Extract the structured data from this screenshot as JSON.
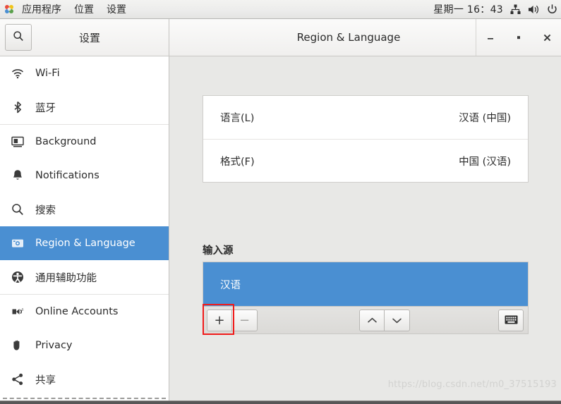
{
  "top_panel": {
    "app_icon_name": "gnome-applications-icon",
    "menus": [
      {
        "label": "应用程序",
        "name": "menu-applications"
      },
      {
        "label": "位置",
        "name": "menu-places"
      },
      {
        "label": "设置",
        "name": "menu-settings"
      }
    ],
    "clock": "星期一 16：43",
    "tray": [
      {
        "name": "network-icon"
      },
      {
        "name": "volume-icon"
      },
      {
        "name": "power-icon"
      }
    ]
  },
  "header": {
    "search_icon": "search-icon",
    "sidebar_title": "设置",
    "page_title": "Region & Language",
    "window_controls": {
      "minimize": "minimize-icon",
      "maximize": "maximize-icon",
      "close": "close-icon"
    }
  },
  "sidebar": {
    "items": [
      {
        "label": "Wi-Fi",
        "icon": "wifi-icon",
        "selected": false
      },
      {
        "label": "蓝牙",
        "icon": "bluetooth-icon",
        "selected": false
      },
      {
        "label": "Background",
        "icon": "background-icon",
        "selected": false
      },
      {
        "label": "Notifications",
        "icon": "bell-icon",
        "selected": false
      },
      {
        "label": "搜索",
        "icon": "search-icon",
        "selected": false
      },
      {
        "label": "Region & Language",
        "icon": "region-language-icon",
        "selected": true
      },
      {
        "label": "通用辅助功能",
        "icon": "accessibility-icon",
        "selected": false
      },
      {
        "label": "Online Accounts",
        "icon": "online-accounts-icon",
        "selected": false
      },
      {
        "label": "Privacy",
        "icon": "privacy-hand-icon",
        "selected": false
      },
      {
        "label": "共享",
        "icon": "sharing-icon",
        "selected": false
      }
    ]
  },
  "content": {
    "locale_rows": [
      {
        "label": "语言(L)",
        "value": "汉语 (中国)"
      },
      {
        "label": "格式(F)",
        "value": "中国 (汉语)"
      }
    ],
    "input_sources": {
      "heading": "输入源",
      "rows": [
        {
          "label": "汉语",
          "selected": true
        }
      ],
      "toolbar": {
        "add_label": "+",
        "remove_label": "−",
        "move_up_label": "⌃",
        "move_down_label": "⌄",
        "keyboard_label": "keyboard-icon"
      },
      "highlight_color": "#f01b1b"
    },
    "watermark": "https://blog.csdn.net/m0_37515193"
  },
  "colors": {
    "accent_blue": "#4a8fd2",
    "panel_bg": "#e8e8e6",
    "highlight_red": "#f01b1b"
  }
}
